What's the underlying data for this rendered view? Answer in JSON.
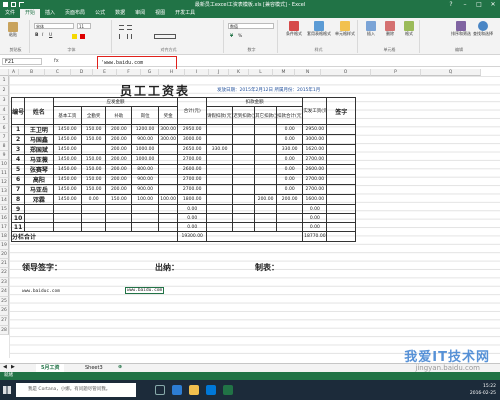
{
  "window": {
    "title": "最新员工excel工资表模板.xls  [兼容模式] - Excel"
  },
  "ribbon_tabs": [
    "文件",
    "开始",
    "插入",
    "页面布局",
    "公式",
    "数据",
    "审阅",
    "视图",
    "开发工具"
  ],
  "ribbon": {
    "font_name": "宋体",
    "font_size": "11",
    "number_format": "数值",
    "groups": {
      "clipboard": "剪贴板",
      "font": "字体",
      "alignment": "对齐方式",
      "number": "数字",
      "styles": "样式",
      "cells": "单元格",
      "editing": "编辑"
    },
    "buttons": {
      "paste": "粘贴",
      "conditional": "条件格式",
      "table_format": "套用表格格式",
      "cell_style": "单元格样式",
      "insert": "插入",
      "delete": "删除",
      "format": "格式",
      "sort": "排序和筛选",
      "find": "查找和选择"
    }
  },
  "formula_bar": {
    "name_box": "F21",
    "fx": "fx",
    "content": "'www.baidu.com"
  },
  "columns": [
    "A",
    "B",
    "C",
    "D",
    "E",
    "F",
    "G",
    "H",
    "I",
    "J",
    "K",
    "L",
    "M",
    "N",
    "O",
    "P",
    "Q"
  ],
  "rows": [
    "1",
    "2",
    "3",
    "4",
    "5",
    "6",
    "7",
    "8",
    "9",
    "10",
    "11",
    "12",
    "13",
    "14",
    "15",
    "16",
    "17",
    "18",
    "19",
    "20",
    "21",
    "22",
    "23",
    "24",
    "25",
    "26",
    "27",
    "28"
  ],
  "sheet": {
    "title": "员工工资表",
    "header_info": "发放日期：2015年2月12日  所属月份：2015年1月",
    "head": {
      "no": "编号",
      "name": "姓名",
      "payable": "应发金额",
      "deduct": "扣款金额",
      "actual": "实发工资(元)",
      "sign": "签字",
      "basic": "基本工资",
      "allow": "全勤奖",
      "bonus": "补助",
      "post": "岗位",
      "award": "奖金",
      "subtotal": "合计(元)",
      "leave": "请假扣款(元)",
      "late": "迟到扣款(元)",
      "other": "其它扣款(元)",
      "dsum": "扣款合计(元)"
    },
    "rows": [
      {
        "no": "1",
        "name": "王卫明",
        "v": [
          "1450.00",
          "150.00",
          "200.00",
          "1200.00",
          "300.00",
          "2950.00",
          "",
          "",
          "",
          "0.00",
          "2950.00"
        ]
      },
      {
        "no": "2",
        "name": "马国鑫",
        "v": [
          "1450.00",
          "150.00",
          "200.00",
          "900.00",
          "300.00",
          "3000.00",
          "",
          "",
          "",
          "0.00",
          "3000.00"
        ]
      },
      {
        "no": "3",
        "name": "郑国斌",
        "v": [
          "1450.00",
          "",
          "200.00",
          "1000.00",
          "",
          "2650.00",
          "330.00",
          "",
          "",
          "330.00",
          "1620.00"
        ]
      },
      {
        "no": "4",
        "name": "马亚薇",
        "v": [
          "1450.00",
          "150.00",
          "200.00",
          "1000.00",
          "",
          "2700.00",
          "",
          "",
          "",
          "0.00",
          "2700.00"
        ]
      },
      {
        "no": "5",
        "name": "张赛琴",
        "v": [
          "1450.00",
          "150.00",
          "200.00",
          "800.00",
          "",
          "2600.00",
          "",
          "",
          "",
          "0.00",
          "2600.00"
        ]
      },
      {
        "no": "6",
        "name": "高阳",
        "v": [
          "1450.00",
          "150.00",
          "200.00",
          "900.00",
          "",
          "2700.00",
          "",
          "",
          "",
          "0.00",
          "2700.00"
        ]
      },
      {
        "no": "7",
        "name": "马亚岳",
        "v": [
          "1450.00",
          "150.00",
          "200.00",
          "900.00",
          "",
          "2700.00",
          "",
          "",
          "",
          "0.00",
          "2700.00"
        ]
      },
      {
        "no": "8",
        "name": "邓霖",
        "v": [
          "1450.00",
          "0.00",
          "150.00",
          "100.00",
          "100.00",
          "1800.00",
          "",
          "",
          "200.00",
          "200.00",
          "1600.00"
        ]
      },
      {
        "no": "9",
        "name": "",
        "v": [
          "",
          "",
          "",
          "",
          "",
          "0.00",
          "",
          "",
          "",
          "",
          "0.00"
        ]
      },
      {
        "no": "10",
        "name": "",
        "v": [
          "",
          "",
          "",
          "",
          "",
          "0.00",
          "",
          "",
          "",
          "",
          "0.00"
        ]
      },
      {
        "no": "11",
        "name": "",
        "v": [
          "",
          "",
          "",
          "",
          "",
          "0.00",
          "",
          "",
          "",
          "",
          "0.00"
        ]
      }
    ],
    "total_label": "分栏合计",
    "total_sub": "19300.00",
    "total_actual": "18770.00",
    "leader": "领导签字：",
    "cashier": "出纳：",
    "maker": "制表：",
    "cell_url1": "www.baiduc.com",
    "cell_url2": "www.baidu.com"
  },
  "sheet_tabs": [
    "5月工资",
    "Sheet3"
  ],
  "status": "就绪",
  "taskbar": {
    "search": "我是 Cortana，小娜。有问题尽管问我。",
    "time": "15:22",
    "date": "2016-02-25"
  },
  "watermark": "我爱IT技术网",
  "watermark_url": "jingyan.baidu.com"
}
